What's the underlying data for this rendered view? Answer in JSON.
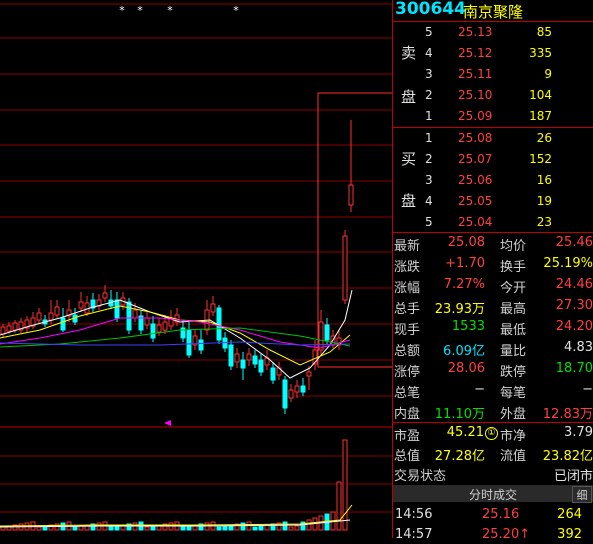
{
  "stock": {
    "code": "300644",
    "name": "南京聚隆"
  },
  "orderbook": {
    "sell_label_1": "卖",
    "sell_label_2": "盘",
    "buy_label_1": "买",
    "buy_label_2": "盘",
    "asks": [
      {
        "level": "5",
        "price": "25.13",
        "volume": "85"
      },
      {
        "level": "4",
        "price": "25.12",
        "volume": "335"
      },
      {
        "level": "3",
        "price": "25.11",
        "volume": "9"
      },
      {
        "level": "2",
        "price": "25.10",
        "volume": "104"
      },
      {
        "level": "1",
        "price": "25.09",
        "volume": "187"
      }
    ],
    "bids": [
      {
        "level": "1",
        "price": "25.08",
        "volume": "26"
      },
      {
        "level": "2",
        "price": "25.07",
        "volume": "152"
      },
      {
        "level": "3",
        "price": "25.06",
        "volume": "16"
      },
      {
        "level": "4",
        "price": "25.05",
        "volume": "19"
      },
      {
        "level": "5",
        "price": "25.04",
        "volume": "23"
      }
    ]
  },
  "quote": {
    "rows": [
      {
        "l": "最新",
        "lv": "25.08",
        "lc": "red",
        "r": "均价",
        "rv": "25.46",
        "rc": "red"
      },
      {
        "l": "涨跌",
        "lv": "+1.70",
        "lc": "red",
        "r": "换手",
        "rv": "25.19%",
        "rc": "yellow"
      },
      {
        "l": "涨幅",
        "lv": "7.27%",
        "lc": "red",
        "r": "今开",
        "rv": "24.46",
        "rc": "red"
      },
      {
        "l": "总手",
        "lv": "23.93万",
        "lc": "yellow",
        "r": "最高",
        "rv": "27.30",
        "rc": "red"
      },
      {
        "l": "现手",
        "lv": "1533",
        "lc": "green",
        "r": "最低",
        "rv": "24.20",
        "rc": "red"
      },
      {
        "l": "总额",
        "lv": "6.09亿",
        "lc": "cyan",
        "r": "量比",
        "rv": "4.83",
        "rc": "white"
      },
      {
        "l": "涨停",
        "lv": "28.06",
        "lc": "red",
        "r": "跌停",
        "rv": "18.70",
        "rc": "green"
      },
      {
        "l": "总笔",
        "lv": "−",
        "lc": "white",
        "r": "每笔",
        "rv": "−",
        "rc": "white"
      },
      {
        "l": "内盘",
        "lv": "11.10万",
        "lc": "green",
        "r": "外盘",
        "rv": "12.83万",
        "rc": "red"
      }
    ],
    "pe_label": "市盈",
    "pe_value": "45.21",
    "pe_badge": "①",
    "pb_label": "市净",
    "pb_value": "3.79",
    "mv_label": "总值",
    "mv_value": "27.28亿",
    "float_label": "流值",
    "float_value": "23.82亿",
    "status_label": "交易状态",
    "status_value": "已闭市"
  },
  "ticks": {
    "title": "分时成交",
    "detail_button": "细",
    "rows": [
      {
        "time": "14:56",
        "price": "25.16",
        "volume": "264"
      },
      {
        "time": "14:57",
        "price": "25.20↑",
        "volume": "392"
      }
    ]
  },
  "chart_data": {
    "type": "candlestick",
    "markers": [
      "* *",
      "*",
      "*"
    ],
    "price_lines": "red-horizontal-grid",
    "candles_note": "daily candles with MA lines; last candle surges",
    "volume_peak_last": true
  },
  "colors": {
    "up": "#ff3030",
    "down": "#00ffff",
    "grid": "#8b0000",
    "ma5": "#ffffff",
    "ma10": "#ffff00",
    "ma20": "#ff00ff",
    "ma60": "#00c000"
  }
}
